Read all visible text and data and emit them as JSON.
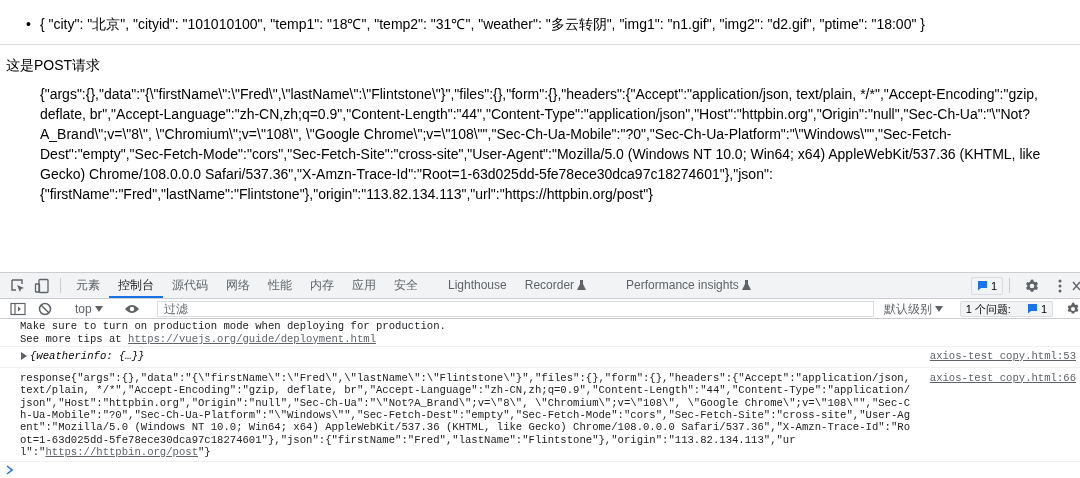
{
  "page": {
    "list_marker": "•",
    "list_items": [
      "{ \"city\": \"北京\", \"cityid\": \"101010100\", \"temp1\": \"18℃\", \"temp2\": \"31℃\", \"weather\": \"多云转阴\", \"img1\": \"n1.gif\", \"img2\": \"d2.gif\", \"ptime\": \"18:00\" }"
    ],
    "heading": "这是POST请求",
    "response": "{\"args\":{},\"data\":\"{\\\"firstName\\\":\\\"Fred\\\",\\\"lastName\\\":\\\"Flintstone\\\"}\",\"files\":{},\"form\":{},\"headers\":{\"Accept\":\"application/json, text/plain, */*\",\"Accept-Encoding\":\"gzip, deflate, br\",\"Accept-Language\":\"zh-CN,zh;q=0.9\",\"Content-Length\":\"44\",\"Content-Type\":\"application/json\",\"Host\":\"httpbin.org\",\"Origin\":\"null\",\"Sec-Ch-Ua\":\"\\\"Not?A_Brand\\\";v=\\\"8\\\", \\\"Chromium\\\";v=\\\"108\\\", \\\"Google Chrome\\\";v=\\\"108\\\"\",\"Sec-Ch-Ua-Mobile\":\"?0\",\"Sec-Ch-Ua-Platform\":\"\\\"Windows\\\"\",\"Sec-Fetch-Dest\":\"empty\",\"Sec-Fetch-Mode\":\"cors\",\"Sec-Fetch-Site\":\"cross-site\",\"User-Agent\":\"Mozilla/5.0 (Windows NT 10.0; Win64; x64) AppleWebKit/537.36 (KHTML, like Gecko) Chrome/108.0.0.0 Safari/537.36\",\"X-Amzn-Trace-Id\":\"Root=1-63d025dd-5fe78ece30dca97c18274601\"},\"json\":{\"firstName\":\"Fred\",\"lastName\":\"Flintstone\"},\"origin\":\"113.82.134.113\",\"url\":\"https://httpbin.org/post\"}"
  },
  "devtools": {
    "tabs": [
      {
        "label": "元素",
        "selected": false,
        "experimental": false
      },
      {
        "label": "控制台",
        "selected": true,
        "experimental": false
      },
      {
        "label": "源代码",
        "selected": false,
        "experimental": false
      },
      {
        "label": "网络",
        "selected": false,
        "experimental": false
      },
      {
        "label": "性能",
        "selected": false,
        "experimental": false
      },
      {
        "label": "内存",
        "selected": false,
        "experimental": false
      },
      {
        "label": "应用",
        "selected": false,
        "experimental": false
      },
      {
        "label": "安全",
        "selected": false,
        "experimental": false
      },
      {
        "label": "Lighthouse",
        "selected": false,
        "experimental": false
      },
      {
        "label": "Recorder",
        "selected": false,
        "experimental": true
      },
      {
        "label": "Performance insights",
        "selected": false,
        "experimental": true
      }
    ],
    "issues_count": "1",
    "context": "top",
    "filter": {
      "placeholder": "过滤"
    },
    "log_level": "默认级别",
    "issues_label": "1 个问题:",
    "issues_badge": "1",
    "messages": [
      {
        "kind": "notice",
        "line": "Make sure to turn on production mode when deploying for production.",
        "prefix": "See more tips at ",
        "link": "https://vuejs.org/guide/deployment.html"
      },
      {
        "kind": "object",
        "expanded": false,
        "text": "{weatherinfo: {…}}",
        "source": "axios-test copy.html:53"
      },
      {
        "kind": "log",
        "text": "response{\"args\":{},\"data\":\"{\\\"firstName\\\":\\\"Fred\\\",\\\"lastName\\\":\\\"Flintstone\\\"}\",\"files\":{},\"form\":{},\"headers\":{\"Accept\":\"application/json, text/plain, */*\",\"Accept-Encoding\":\"gzip, deflate, br\",\"Accept-Language\":\"zh-CN,zh;q=0.9\",\"Content-Length\":\"44\",\"Content-Type\":\"application/json\",\"Host\":\"httpbin.org\",\"Origin\":\"null\",\"Sec-Ch-Ua\":\"\\\"Not?A_Brand\\\";v=\\\"8\\\", \\\"Chromium\\\";v=\\\"108\\\", \\\"Google Chrome\\\";v=\\\"108\\\"\",\"Sec-Ch-Ua-Mobile\":\"?0\",\"Sec-Ch-Ua-Platform\":\"\\\"Windows\\\"\",\"Sec-Fetch-Dest\":\"empty\",\"Sec-Fetch-Mode\":\"cors\",\"Sec-Fetch-Site\":\"cross-site\",\"User-Agent\":\"Mozilla/5.0 (Windows NT 10.0; Win64; x64) AppleWebKit/537.36 (KHTML, like Gecko) Chrome/108.0.0.0 Safari/537.36\",\"X-Amzn-Trace-Id\":\"Root=1-63d025dd-5fe78ece30dca97c18274601\"},\"json\":{\"firstName\":\"Fred\",\"lastName\":\"Flintstone\"},\"origin\":\"113.82.134.113\",\"url\":\"",
        "link": "https://httpbin.org/post",
        "suffix": "\"}",
        "source": "axios-test copy.html:66"
      }
    ]
  }
}
